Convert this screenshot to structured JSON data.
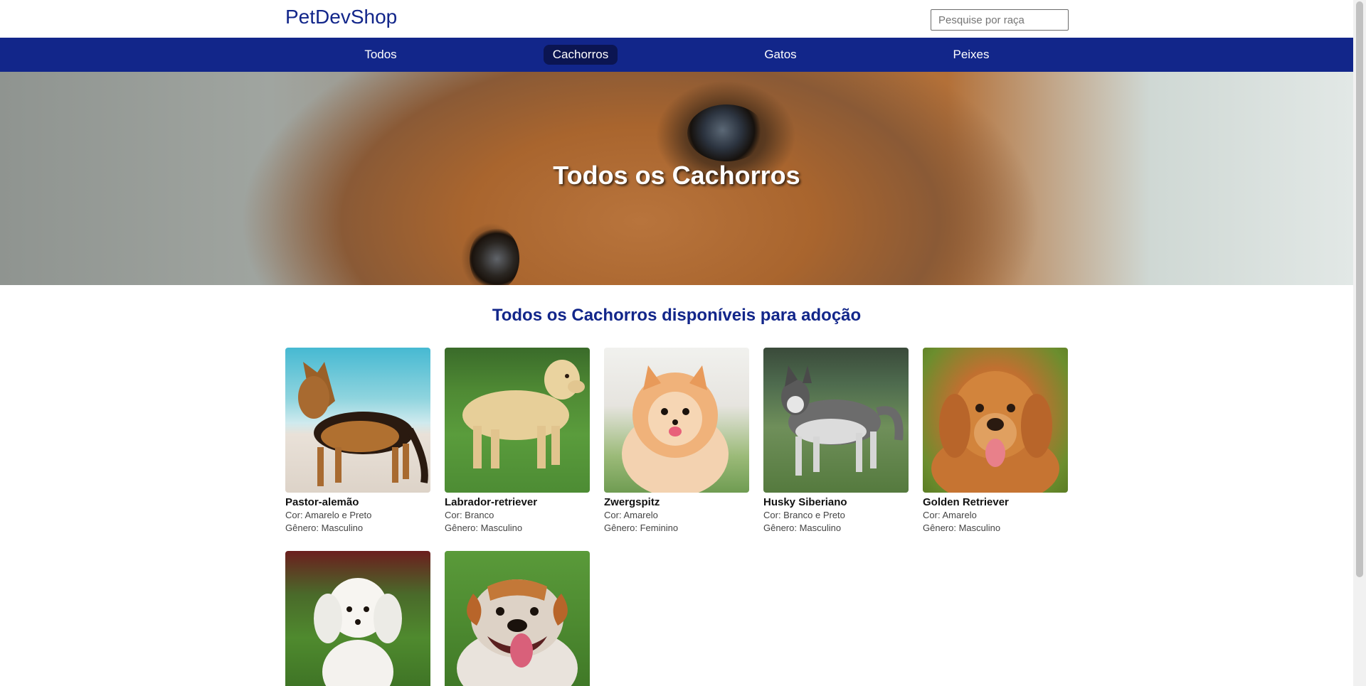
{
  "header": {
    "logo": "PetDevShop",
    "search_placeholder": "Pesquise por raça"
  },
  "nav": {
    "items": [
      {
        "label": "Todos",
        "active": false
      },
      {
        "label": "Cachorros",
        "active": true
      },
      {
        "label": "Gatos",
        "active": false
      },
      {
        "label": "Peixes",
        "active": false
      }
    ]
  },
  "hero": {
    "title": "Todos os Cachorros"
  },
  "section": {
    "title": "Todos os Cachorros disponíveis para adoção"
  },
  "pets": [
    {
      "name": "Pastor-alemão",
      "cor": "Cor: Amarelo e Preto",
      "genero": "Gênero: Masculino"
    },
    {
      "name": "Labrador-retriever",
      "cor": "Cor: Branco",
      "genero": "Gênero: Masculino"
    },
    {
      "name": "Zwergspitz",
      "cor": "Cor: Amarelo",
      "genero": "Gênero: Feminino"
    },
    {
      "name": "Husky Siberiano",
      "cor": "Cor: Branco e Preto",
      "genero": "Gênero: Masculino"
    },
    {
      "name": "Golden Retriever",
      "cor": "Cor: Amarelo",
      "genero": "Gênero: Masculino"
    }
  ],
  "colors": {
    "brand": "#12268a",
    "nav_active": "#0b1552"
  }
}
